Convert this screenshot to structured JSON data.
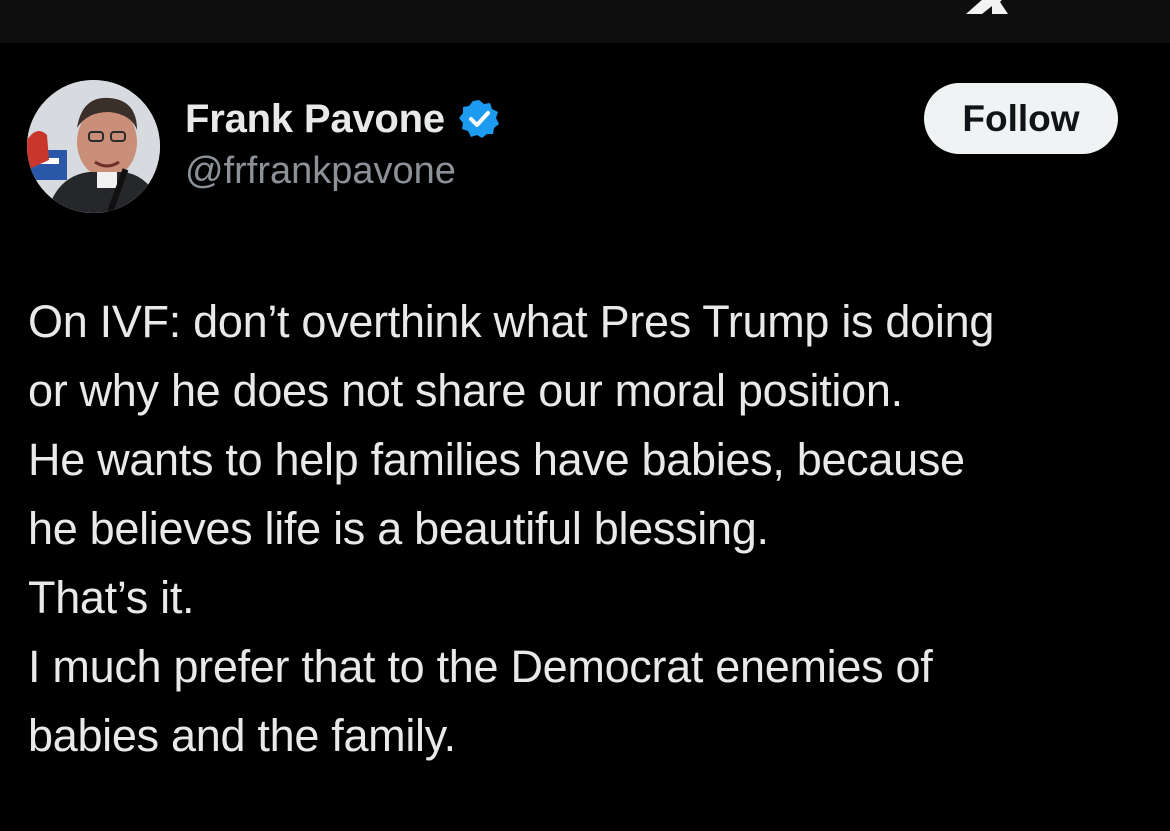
{
  "app": {
    "logo_icon": "x-logo-icon"
  },
  "post": {
    "author": {
      "display_name": "Frank Pavone",
      "handle": "@frfrankpavone",
      "verified_icon": "verified-badge-icon",
      "verified_color": "#1d9bf0",
      "avatar_icon": "profile-photo"
    },
    "follow_label": "Follow",
    "text_lines": [
      "On IVF: don’t overthink what Pres Trump is doing",
      "or why he does not share our moral position.",
      "He wants to help families have babies, because",
      "he believes life is a beautiful blessing.",
      "That’s it.",
      "I much prefer that to the Democrat enemies of",
      "babies and the family."
    ]
  },
  "colors": {
    "background": "#000000",
    "top_bar": "#0e0e0e",
    "primary_text": "#e7e9ea",
    "secondary_text": "#8b9197",
    "follow_bg": "#eff3f4",
    "follow_text": "#0f1419"
  }
}
